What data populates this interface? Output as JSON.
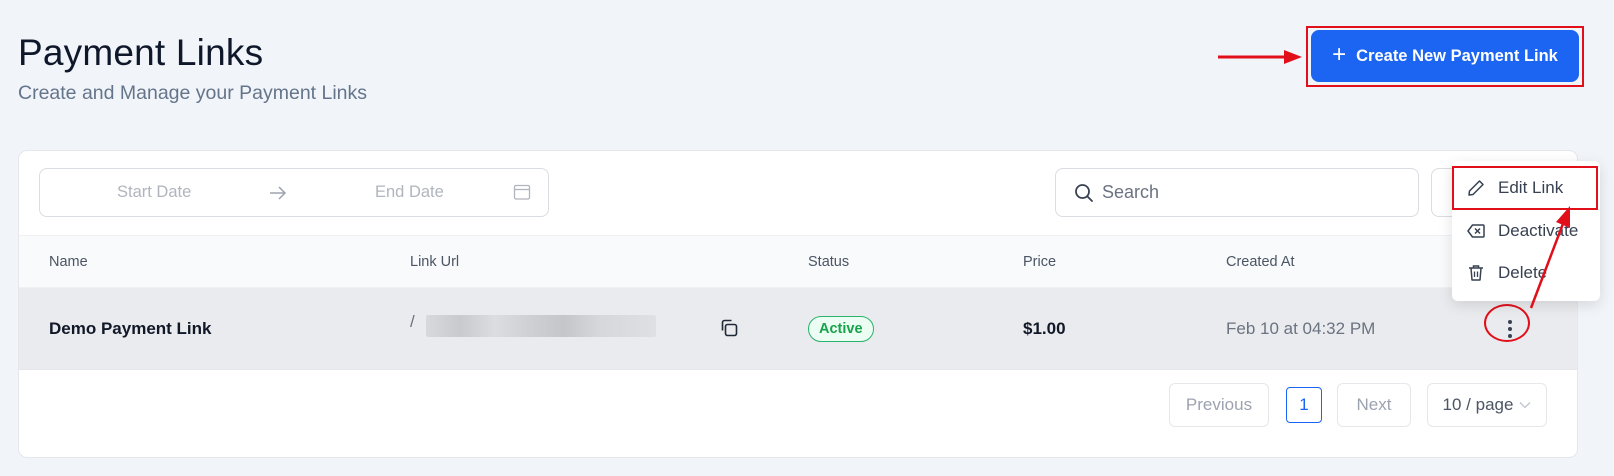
{
  "header": {
    "title": "Payment Links",
    "subtitle": "Create and Manage your Payment Links",
    "create_button_label": "Create New Payment Link"
  },
  "filters": {
    "start_date_placeholder": "Start Date",
    "end_date_placeholder": "End Date",
    "search_placeholder": "Search"
  },
  "table": {
    "columns": [
      "Name",
      "Link Url",
      "Status",
      "Price",
      "Created At"
    ],
    "rows": [
      {
        "name": "Demo Payment Link",
        "link_url_prefix": "/",
        "status": "Active",
        "price": "$1.00",
        "created_at": "Feb 10 at 04:32 PM"
      }
    ]
  },
  "pagination": {
    "previous_label": "Previous",
    "current_page": "1",
    "next_label": "Next",
    "page_size_label": "10 / page"
  },
  "row_menu": {
    "items": [
      {
        "label": "Edit Link",
        "icon": "pencil-icon"
      },
      {
        "label": "Deactivate",
        "icon": "backspace-x-icon"
      },
      {
        "label": "Delete",
        "icon": "trash-icon"
      }
    ]
  },
  "colors": {
    "primary": "#1c64f2",
    "annotation_red": "#e10f1a",
    "status_active": "#16a34a"
  }
}
